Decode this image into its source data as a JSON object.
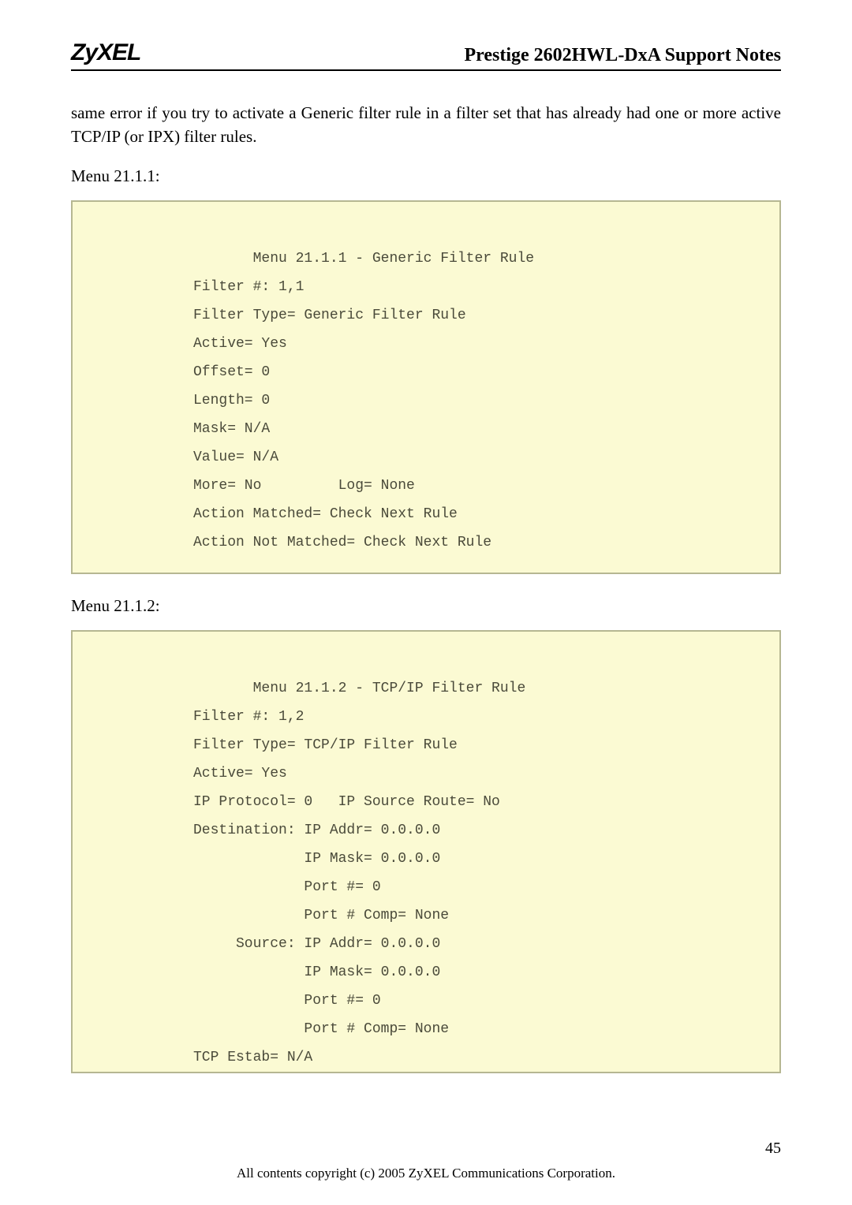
{
  "logo": "ZyXEL",
  "header_title": "Prestige 2602HWL-DxA Support Notes",
  "para1": "same error if you try to activate a Generic filter rule in a filter set that has already had one or more active TCP/IP (or IPX) filter rules.",
  "caption1": "Menu 21.1.1:",
  "code1": {
    "l1": "       Menu 21.1.1 - Generic Filter Rule",
    "l2": "Filter #: 1,1",
    "l3": "Filter Type= Generic Filter Rule",
    "l4": "Active= Yes",
    "l5": "Offset= 0",
    "l6": "Length= 0",
    "l7": "Mask= N/A",
    "l8": "Value= N/A",
    "l9": "More= No         Log= None",
    "l10": "Action Matched= Check Next Rule",
    "l11": "Action Not Matched= Check Next Rule"
  },
  "caption2": "Menu 21.1.2:",
  "code2": {
    "l1": "       Menu 21.1.2 - TCP/IP Filter Rule",
    "l2": "Filter #: 1,2",
    "l3": "Filter Type= TCP/IP Filter Rule",
    "l4": "Active= Yes",
    "l5": "IP Protocol= 0   IP Source Route= No",
    "l6": "Destination: IP Addr= 0.0.0.0",
    "l7": "             IP Mask= 0.0.0.0",
    "l8": "             Port #= 0",
    "l9": "             Port # Comp= None",
    "l10": "     Source: IP Addr= 0.0.0.0",
    "l11": "             IP Mask= 0.0.0.0",
    "l12": "             Port #= 0",
    "l13": "             Port # Comp= None",
    "l14": "TCP Estab= N/A"
  },
  "page_num": "45",
  "footer": "All contents copyright (c) 2005 ZyXEL Communications Corporation."
}
